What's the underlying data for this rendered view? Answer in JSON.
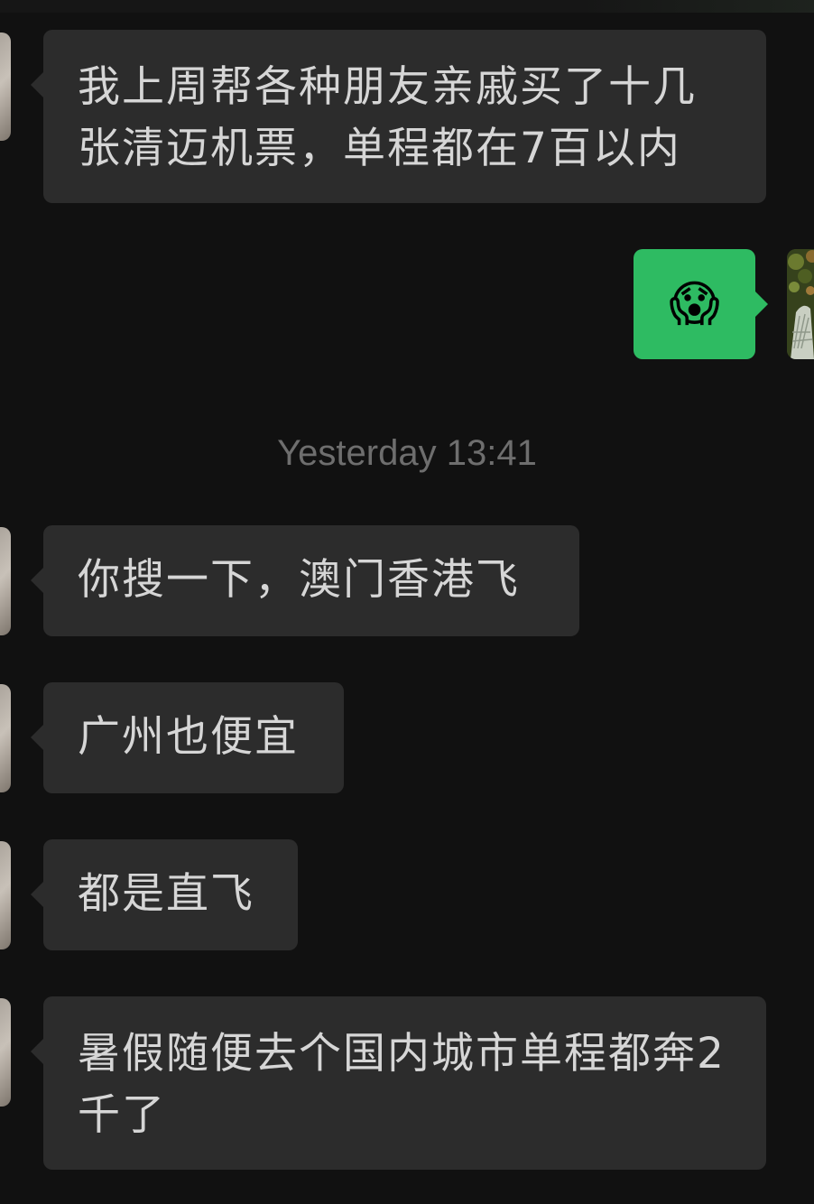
{
  "messages": [
    {
      "text": "我上周帮各种朋友亲戚买了十几张清迈机票，单程都在7百以内"
    },
    {
      "emoji": "😱"
    },
    {
      "text": "你搜一下，澳门香港飞"
    },
    {
      "text": "广州也便宜"
    },
    {
      "text": "都是直飞"
    },
    {
      "text": "暑假随便去个国内城市单程都奔2千了"
    }
  ],
  "timestamp": "Yesterday 13:41",
  "colors": {
    "background": "#111111",
    "received_bubble": "#2c2c2c",
    "sent_bubble": "#2ebb62",
    "text": "#d6d6d6",
    "timestamp": "#6e6e6e"
  }
}
